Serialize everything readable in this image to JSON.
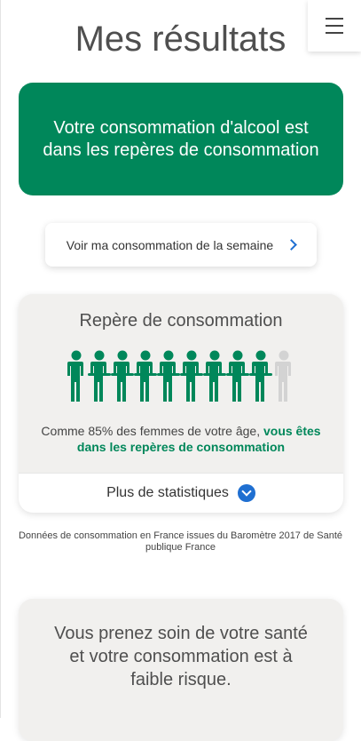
{
  "header": {
    "title": "Mes résultats",
    "menu_icon": "hamburger-menu-icon"
  },
  "result_banner": {
    "text": "Votre consommation d'alcool est dans les repères de consommation",
    "color": "#00875a"
  },
  "week_button": {
    "label": "Voir ma consommation de la semaine",
    "icon": "chevron-right-icon"
  },
  "stat_card": {
    "title": "Repère de consommation",
    "people_total": 10,
    "people_highlighted": 9,
    "highlight_color": "#00875a",
    "muted_color": "#d3d3d3",
    "text_prefix": "Comme 85% des femmes de votre âge, ",
    "text_highlight": "vous êtes dans les repères de consommation",
    "more_stats_label": "Plus de statistiques",
    "more_stats_icon": "chevron-down-circle-icon"
  },
  "source_note": "Données de consommation en France issues du Baromètre 2017 de Santé publique France",
  "risk_card": {
    "text": "Vous prenez soin de votre santé et votre consommation est à faible risque."
  }
}
